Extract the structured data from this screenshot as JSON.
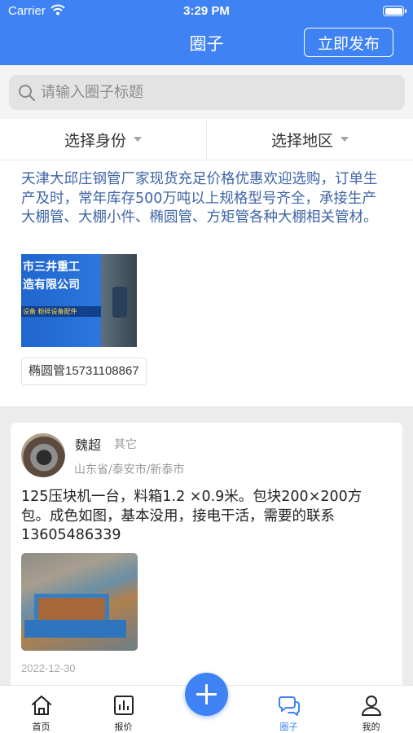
{
  "status_bar": {
    "carrier": "Carrier",
    "time": "3:29 PM"
  },
  "header": {
    "title": "圈子",
    "publish_label": "立即发布"
  },
  "search": {
    "placeholder": "请输入圈子标题",
    "value": ""
  },
  "filters": {
    "identity": "选择身份",
    "region": "选择地区"
  },
  "posts": [
    {
      "text": "天津大邱庄钢管厂家现货充足价格优惠欢迎选购，订单生产及时，常年库存500万吨以上规格型号齐全，承接生产大棚管、大棚小件、椭圆管、方矩管各种大棚相关管材。",
      "image_lines": [
        "市三井重工",
        "造有限公司",
        "设备 粉碎设备配件"
      ],
      "tag": "椭圆管15731108867"
    },
    {
      "author": "魏超",
      "role": "其它",
      "location": "山东省/泰安市/新泰市",
      "text": "125压块机一台，料箱1.2 ×0.9米。包块200×200方包。成色如图，基本没用，接电干活，需要的联系13605486339",
      "date": "2022-12-30"
    }
  ],
  "tabbar": {
    "items": [
      {
        "label": "首页",
        "icon": "home-icon"
      },
      {
        "label": "报价",
        "icon": "chart-icon"
      },
      {
        "label": "圈子",
        "icon": "chat-bubbles-icon",
        "active": true
      },
      {
        "label": "我的",
        "icon": "user-icon"
      }
    ],
    "fab_icon": "plus-icon"
  },
  "colors": {
    "primary": "#3e82f3",
    "card1_text": "#3e64a6",
    "muted": "#999999"
  }
}
